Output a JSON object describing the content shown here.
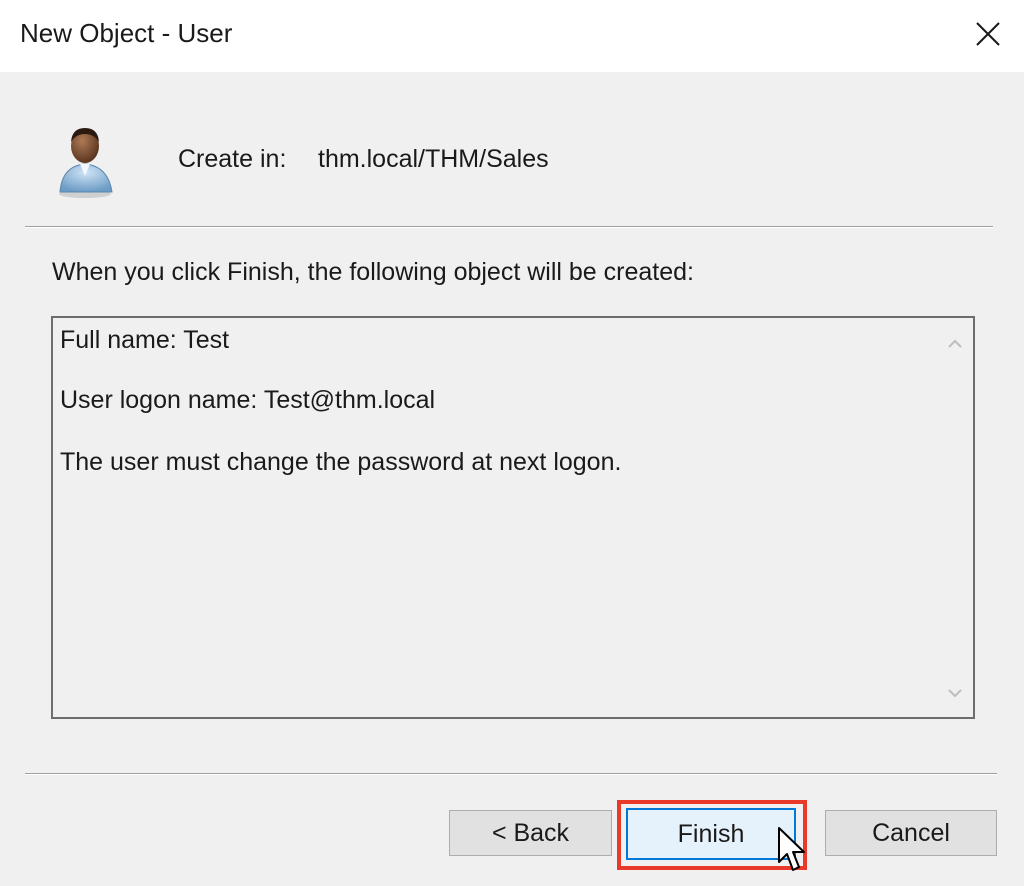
{
  "window": {
    "title": "New Object - User"
  },
  "header": {
    "create_in_label": "Create in:",
    "create_in_value": "thm.local/THM/Sales"
  },
  "instruction": "When you click Finish, the following object will be created:",
  "summary": {
    "lines": [
      "Full name: Test",
      "User logon name: Test@thm.local",
      "The user must change the password at next logon."
    ]
  },
  "buttons": {
    "back": "< Back",
    "finish": "Finish",
    "cancel": "Cancel"
  },
  "colors": {
    "dialog_bg": "#f0f0f0",
    "title_bg": "#ffffff",
    "highlight": "#e8392a",
    "focus_border": "#0078d7"
  },
  "icons": {
    "close": "close-icon",
    "user": "user-icon",
    "scroll_up": "chevron-up-icon",
    "scroll_down": "chevron-down-icon",
    "cursor": "mouse-pointer-icon"
  }
}
